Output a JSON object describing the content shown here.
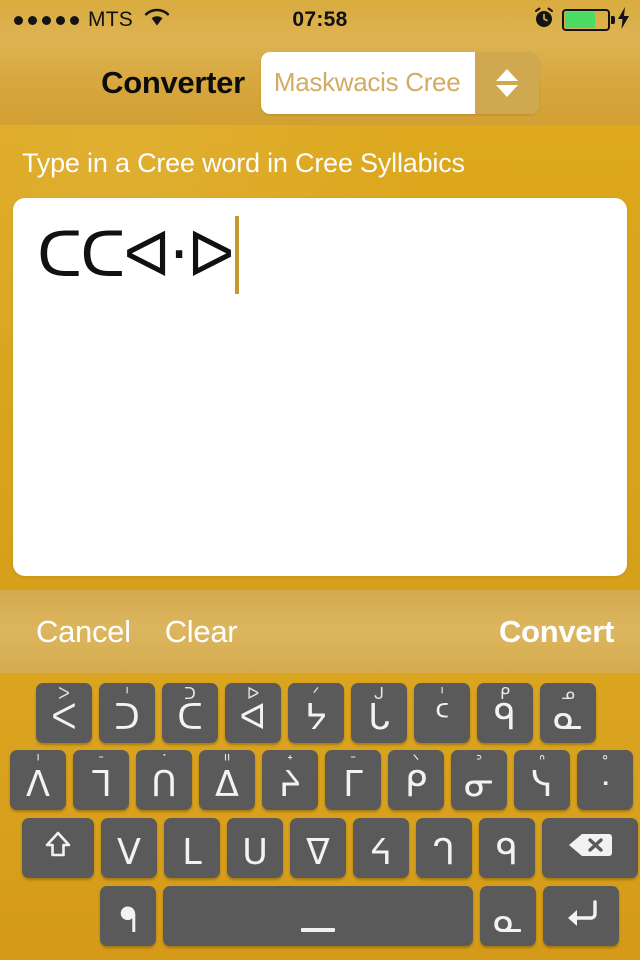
{
  "status_bar": {
    "signal_dots": 5,
    "carrier": "MTS",
    "wifi_icon": "wifi-icon",
    "time": "07:58",
    "alarm_icon": "alarm-clock-icon",
    "battery_icon": "battery-icon",
    "battery_color": "#4cd964",
    "battery_level_pct": 68,
    "charging_icon": "lightning-bolt-icon"
  },
  "nav_bar": {
    "title": "Converter",
    "language_picker": {
      "value": "Maskwacis Cree",
      "stepper_up_icon": "triangle-up-icon",
      "stepper_down_icon": "triangle-down-icon"
    }
  },
  "content": {
    "prompt": "Type in a Cree word in Cree Syllabics",
    "text_value": "ᑕᑕᐊ·ᐅ",
    "caret_color": "#c79a30"
  },
  "toolbar": {
    "cancel_label": "Cancel",
    "clear_label": "Clear",
    "convert_label": "Convert"
  },
  "keyboard": {
    "key_color": "#5a5a5a",
    "rows": [
      {
        "name": "row-1",
        "lead_spacer": true,
        "keys": [
          {
            "main": "ᐸ",
            "sup": "ᐳ"
          },
          {
            "main": "ᑐ",
            "sup": "ᑊ"
          },
          {
            "main": "ᑕ",
            "sup": "ᑐ"
          },
          {
            "main": "ᐊ",
            "sup": "ᐅ"
          },
          {
            "main": "ᔭ",
            "sup": "ᐟ"
          },
          {
            "main": "ᒐ",
            "sup": "ᒍ"
          },
          {
            "main": "ᑦ",
            "sup": "ᑊ"
          },
          {
            "main": "ᑫ",
            "sup": "ᑭ"
          },
          {
            "main": "ᓇ",
            "sup": "ᓄ"
          }
        ]
      },
      {
        "name": "row-2",
        "lead_spacer": false,
        "keys": [
          {
            "main": "ᐱ",
            "sup": "ᑊ"
          },
          {
            "main": "ᒣ",
            "sup": "ᐨ"
          },
          {
            "main": "ᑎ",
            "sup": "ᐝ"
          },
          {
            "main": "ᐃ",
            "sup": "ᐦ"
          },
          {
            "main": "ᔨ",
            "sup": "ᐩ"
          },
          {
            "main": "ᒥ",
            "sup": "ᐨ"
          },
          {
            "main": "ᑭ",
            "sup": "ᐠ"
          },
          {
            "main": "ᓂ",
            "sup": "ᐣ"
          },
          {
            "main": "ᓭ",
            "sup": "ᐢ"
          },
          {
            "main": "ᐧ",
            "sup": "ᐤ"
          }
        ]
      },
      {
        "name": "row-3",
        "lead_spacer": false,
        "keys": [
          {
            "main": "shift-icon",
            "sup": "",
            "type": "shift"
          },
          {
            "main": "ᐯ",
            "sup": ""
          },
          {
            "main": "ᒪ",
            "sup": ""
          },
          {
            "main": "ᑌ",
            "sup": ""
          },
          {
            "main": "ᐁ",
            "sup": ""
          },
          {
            "main": "ᔦ",
            "sup": ""
          },
          {
            "main": "ᒉ",
            "sup": ""
          },
          {
            "main": "ᑫ",
            "sup": ""
          },
          {
            "main": "backspace-icon",
            "sup": "",
            "type": "backspace"
          }
        ]
      },
      {
        "name": "row-4",
        "lead_spacer": false,
        "keys": [
          {
            "main": "ᖳ",
            "sup": "",
            "type": "glyph"
          },
          {
            "main": "space",
            "sup": "",
            "type": "space"
          },
          {
            "main": "ᓇ",
            "sup": "",
            "type": "glyph"
          },
          {
            "main": "return-icon",
            "sup": "",
            "type": "return"
          }
        ]
      }
    ]
  }
}
